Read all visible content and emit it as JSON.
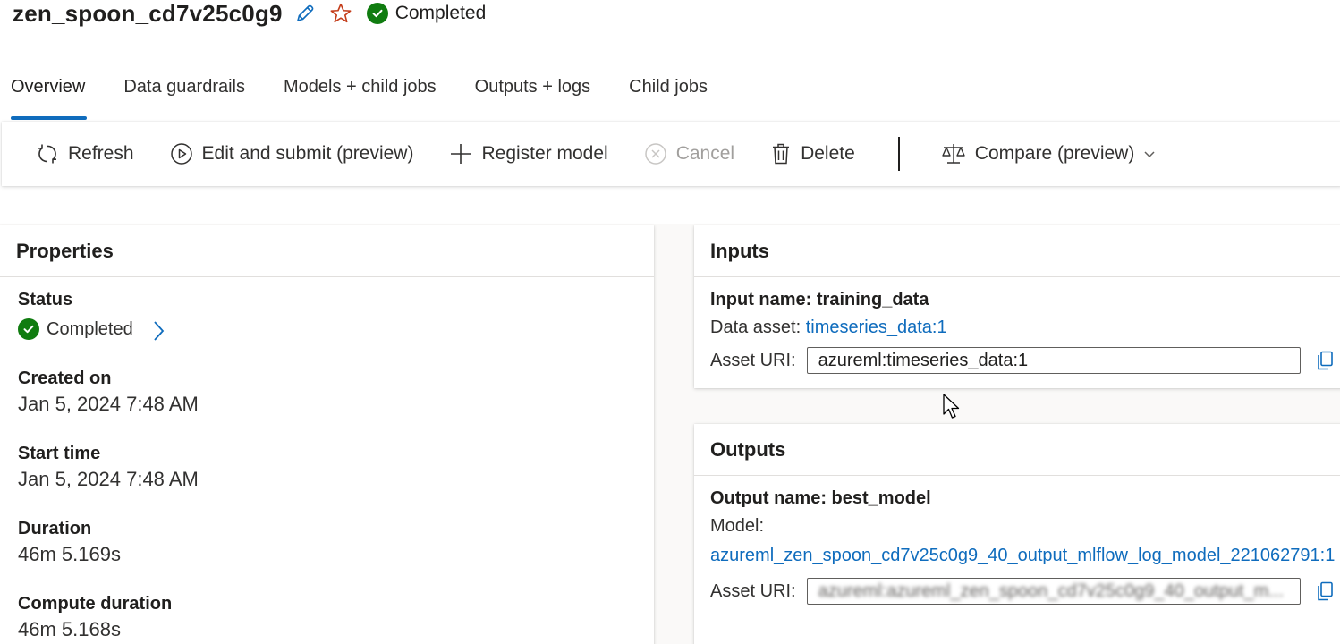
{
  "header": {
    "job_title": "zen_spoon_cd7v25c0g9",
    "status": "Completed"
  },
  "tabs": [
    {
      "label": "Overview"
    },
    {
      "label": "Data guardrails"
    },
    {
      "label": "Models + child jobs"
    },
    {
      "label": "Outputs + logs"
    },
    {
      "label": "Child jobs"
    }
  ],
  "toolbar": {
    "refresh": "Refresh",
    "edit_submit": "Edit and submit (preview)",
    "register_model": "Register model",
    "cancel": "Cancel",
    "delete": "Delete",
    "compare": "Compare (preview)"
  },
  "properties": {
    "title": "Properties",
    "status_label": "Status",
    "status_value": "Completed",
    "created_label": "Created on",
    "created_value": "Jan 5, 2024 7:48 AM",
    "start_label": "Start time",
    "start_value": "Jan 5, 2024 7:48 AM",
    "duration_label": "Duration",
    "duration_value": "46m 5.169s",
    "compute_label": "Compute duration",
    "compute_value": "46m 5.168s"
  },
  "inputs": {
    "title": "Inputs",
    "name_line": "Input name: training_data",
    "asset_prefix": "Data asset: ",
    "asset_link": "timeseries_data:1",
    "uri_label": "Asset URI:",
    "uri_value": "azureml:timeseries_data:1"
  },
  "outputs": {
    "title": "Outputs",
    "name_line": "Output name: best_model",
    "model_label": "Model:",
    "model_link": "azureml_zen_spoon_cd7v25c0g9_40_output_mlflow_log_model_221062791:1",
    "uri_label": "Asset URI:",
    "uri_value": "azureml:azureml_zen_spoon_cd7v25c0g9_40_output_m..."
  },
  "colors": {
    "accent": "#0f6cbd",
    "success": "#107c10",
    "star": "#c43e1c"
  }
}
